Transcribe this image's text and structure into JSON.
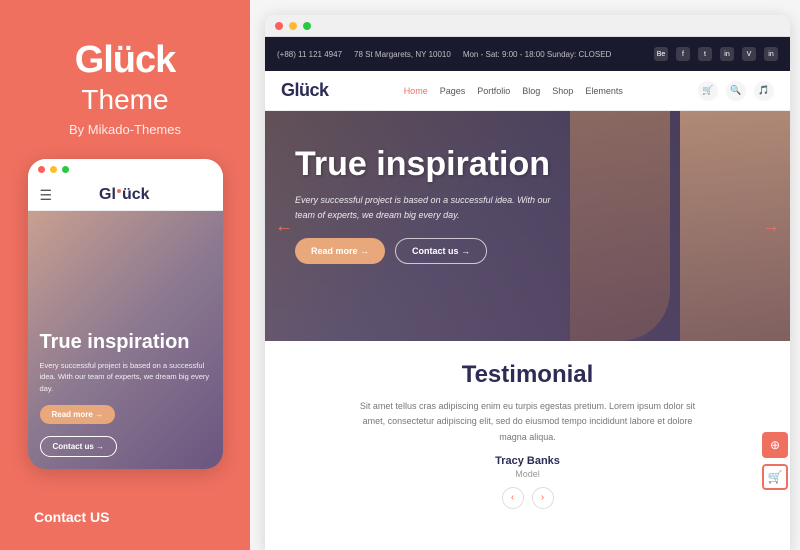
{
  "left": {
    "brand": {
      "title": "Glück",
      "subtitle": "Theme",
      "by_label": "By Mikado-Themes"
    },
    "mobile": {
      "dots": [
        "red",
        "yellow",
        "green"
      ],
      "logo": "Glück",
      "hero_title": "True inspiration",
      "hero_desc": "Every successful project is based on a successful idea. With our team of experts, we dream big every day.",
      "btn_read_more": "Read more →",
      "btn_contact": "Contact us →"
    },
    "contact_us_label": "Contact US"
  },
  "right": {
    "top_bar": {
      "phone": "(+88) 11 121 4947",
      "address": "78 St Margarets, NY 10010",
      "hours": "Mon - Sat: 9:00 - 18:00  Sunday: CLOSED"
    },
    "nav": {
      "logo": "Gluck",
      "menu_items": [
        "Home",
        "Pages",
        "Portfolio",
        "Blog",
        "Shop",
        "Elements"
      ],
      "active_item": "Home"
    },
    "hero": {
      "title": "True inspiration",
      "desc": "Every successful project is based on a successful idea. With our team of experts, we dream big every day.",
      "btn_read_more": "Read more →",
      "btn_contact": "Contact us →"
    },
    "testimonial": {
      "title": "Testimonial",
      "text": "Sit amet tellus cras adipiscing enim eu turpis egestas pretium. Lorem ipsum dolor sit amet, consectetur adipiscing elit, sed do eiusmod tempo incididunt labore et dolore magna aliqua.",
      "author": "Tracy Banks",
      "role": "Model",
      "arrow_left": "‹",
      "arrow_right": "›"
    },
    "social_icons": [
      "Be",
      "f",
      "t",
      "in",
      "V",
      "in"
    ]
  },
  "colors": {
    "salmon": "#f07060",
    "dark_purple": "#2c2c54",
    "white": "#ffffff"
  }
}
